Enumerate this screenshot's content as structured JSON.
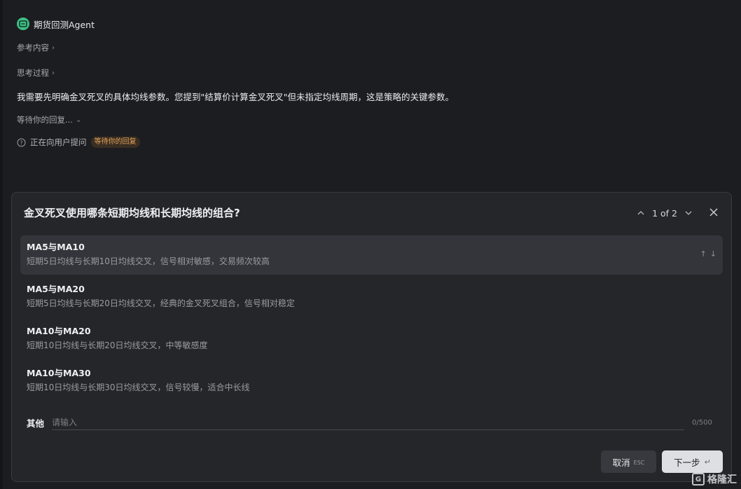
{
  "agent": {
    "name": "期货回测Agent"
  },
  "sections": {
    "reference": "参考内容",
    "thinking": "思考过程",
    "waiting": "等待你的回复..."
  },
  "message": "我需要先明确金叉死叉的具体均线参数。您提到\"结算价计算金叉死叉\"但未指定均线周期，这是策略的关键参数。",
  "status": {
    "text": "正在向用户提问",
    "badge": "等待你的回复"
  },
  "question": {
    "title": "金叉死叉使用哪条短期均线和长期均线的组合?",
    "pager": "1 of 2",
    "options": [
      {
        "title": "MA5与MA10",
        "desc": "短期5日均线与长期10日均线交叉，信号相对敏感，交易频次较高"
      },
      {
        "title": "MA5与MA20",
        "desc": "短期5日均线与长期20日均线交叉，经典的金叉死叉组合，信号相对稳定"
      },
      {
        "title": "MA10与MA20",
        "desc": "短期10日均线与长期20日均线交叉，中等敏感度"
      },
      {
        "title": "MA10与MA30",
        "desc": "短期10日均线与长期30日均线交叉，信号较慢，适合中长线"
      }
    ],
    "other": {
      "label": "其他",
      "placeholder": "请输入",
      "count": "0/500"
    },
    "buttons": {
      "cancel": "取消",
      "cancel_hint": "ESC",
      "next": "下一步"
    }
  },
  "watermark": "格隆汇"
}
